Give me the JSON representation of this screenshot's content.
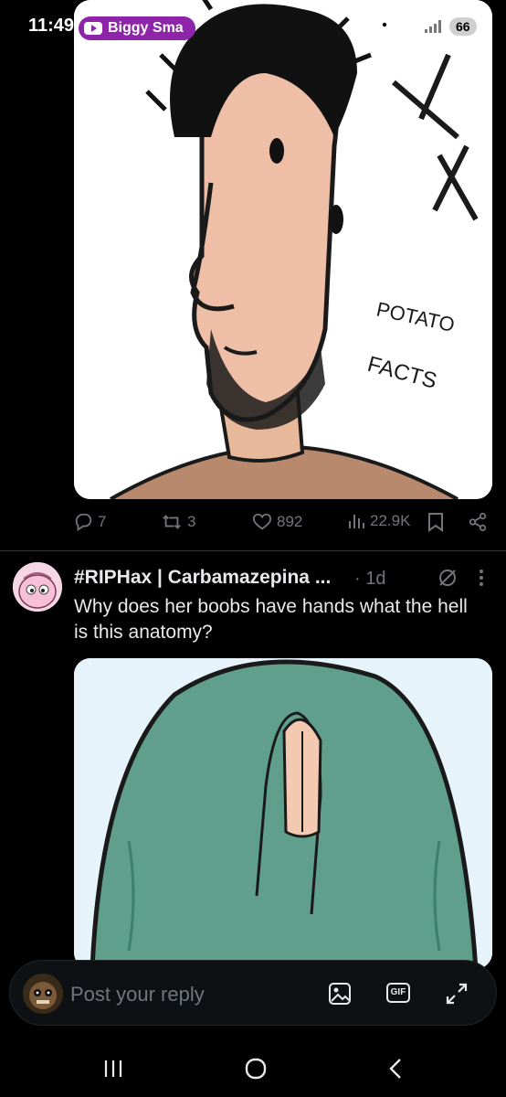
{
  "status_bar": {
    "time": "11:49",
    "media_title": "Biggy Sma",
    "battery": "66"
  },
  "post1": {
    "image_text_line1": "POTATO",
    "image_text_line2": "FACTS",
    "replies": "7",
    "reposts": "3",
    "likes": "892",
    "views": "22.9K"
  },
  "tweet": {
    "author": "#RIPHax | Carbamazepina ...",
    "time": "· 1d",
    "text": "Why does her boobs have hands what the hell is this anatomy?"
  },
  "reply_bar": {
    "placeholder": "Post your reply",
    "gif_label": "GIF"
  },
  "colors": {
    "background": "#000000",
    "muted": "#71767b",
    "text": "#e7e9ea",
    "media_pill": "#8e24aa"
  }
}
